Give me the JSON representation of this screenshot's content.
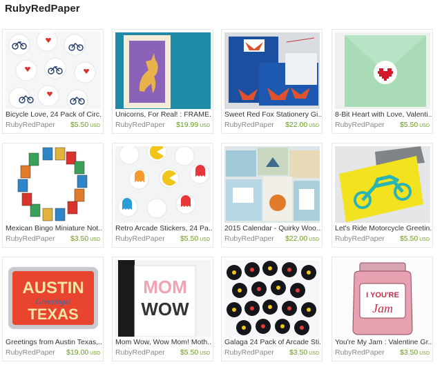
{
  "shop_title": "RubyRedPaper",
  "items": [
    {
      "title": "Bicycle Love, 24 Pack of Circ...",
      "shop": "RubyRedPaper",
      "price": "$5.50",
      "currency": "USD"
    },
    {
      "title": "Unicorns, For Real! : FRAME...",
      "shop": "RubyRedPaper",
      "price": "$19.99",
      "currency": "USD"
    },
    {
      "title": "Sweet Red Fox Stationery Gi...",
      "shop": "RubyRedPaper",
      "price": "$22.00",
      "currency": "USD"
    },
    {
      "title": "8-Bit Heart with Love, Valenti...",
      "shop": "RubyRedPaper",
      "price": "$5.50",
      "currency": "USD"
    },
    {
      "title": "Mexican Bingo Miniature Not...",
      "shop": "RubyRedPaper",
      "price": "$3.50",
      "currency": "USD"
    },
    {
      "title": "Retro Arcade Stickers, 24 Pa...",
      "shop": "RubyRedPaper",
      "price": "$5.50",
      "currency": "USD"
    },
    {
      "title": "2015 Calendar - Quirky Woo...",
      "shop": "RubyRedPaper",
      "price": "$22.00",
      "currency": "USD"
    },
    {
      "title": "Let's Ride Motorcycle Greetin...",
      "shop": "RubyRedPaper",
      "price": "$5.50",
      "currency": "USD"
    },
    {
      "title": "Greetings from Austin Texas,...",
      "shop": "RubyRedPaper",
      "price": "$19.00",
      "currency": "USD"
    },
    {
      "title": "Mom Wow, Wow Mom! Moth...",
      "shop": "RubyRedPaper",
      "price": "$5.50",
      "currency": "USD"
    },
    {
      "title": "Galaga 24 Pack of Arcade Sti...",
      "shop": "RubyRedPaper",
      "price": "$3.50",
      "currency": "USD"
    },
    {
      "title": "You're My Jam : Valentine Gr...",
      "shop": "RubyRedPaper",
      "price": "$3.50",
      "currency": "USD"
    }
  ],
  "artwork_text": {
    "austin_word": "AUSTIN",
    "greetings_word": "Greetings!",
    "texas_word": "TEXAS",
    "mom_word": "MOM",
    "wow_word": "WOW",
    "youre_word": "I YOU'RE",
    "jam_word": "Jam"
  },
  "colors": {
    "price": "#6a9a1f",
    "muted": "#888888",
    "title": "#333333"
  }
}
